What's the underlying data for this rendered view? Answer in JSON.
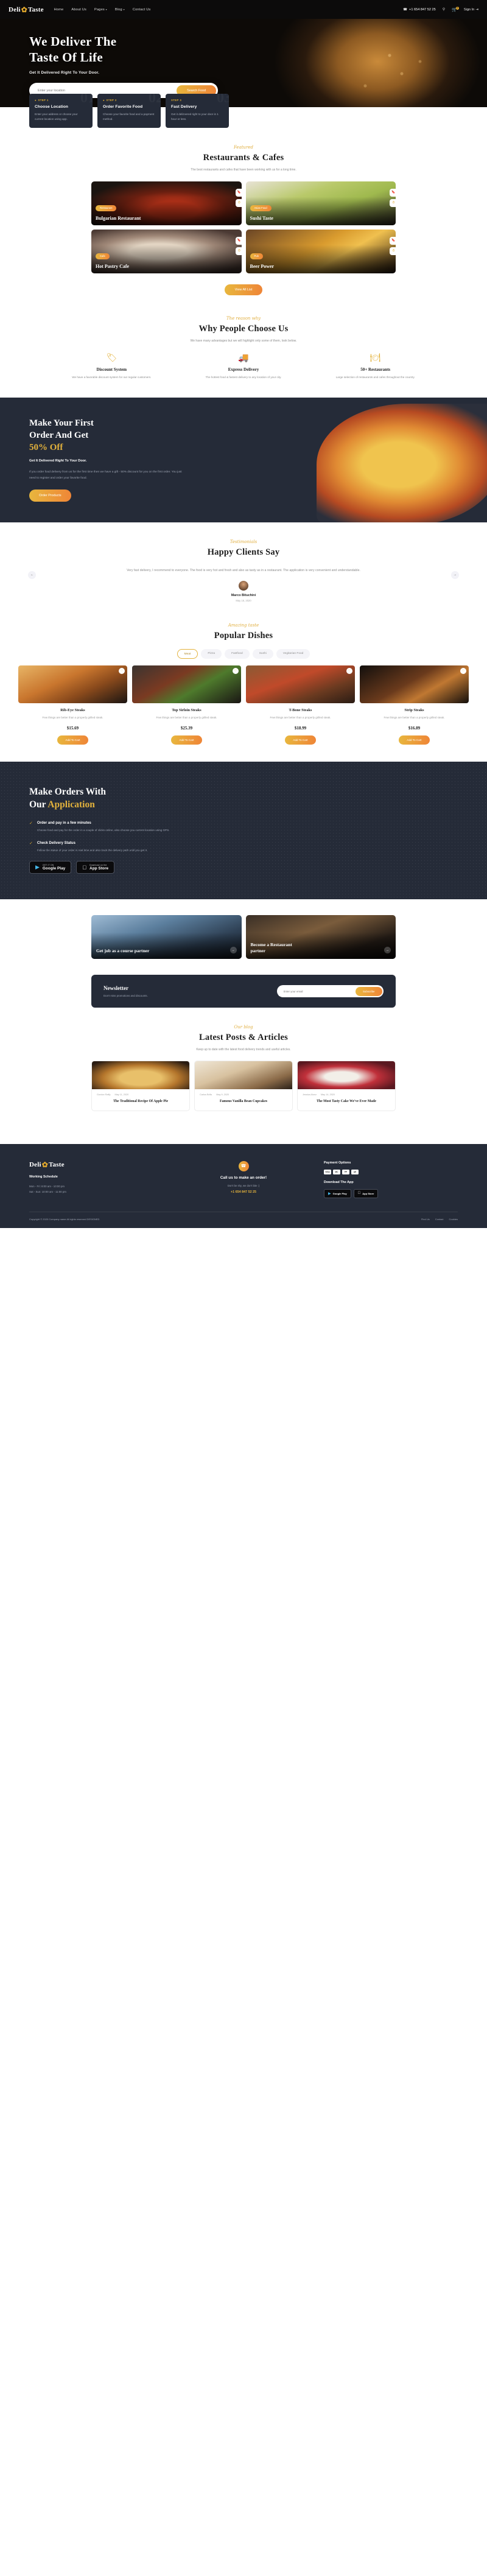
{
  "brand": {
    "name_1": "Deli",
    "name_2": "Taste",
    "flame_icon": "flame-icon"
  },
  "header": {
    "nav": [
      {
        "label": "Home",
        "caret": ""
      },
      {
        "label": "About Us",
        "caret": ""
      },
      {
        "label": "Pages",
        "caret": "▾"
      },
      {
        "label": "Blog",
        "caret": "▾"
      },
      {
        "label": "Contact Us",
        "caret": ""
      }
    ],
    "phone": "+1 654 847 52 25",
    "phone_icon": "phone-icon",
    "search_icon": "search-icon",
    "cart_icon": "cart-icon",
    "cart_count": "0",
    "signin_label": "Sign In",
    "signin_icon": "login-icon"
  },
  "hero": {
    "title_line1": "We Deliver The",
    "title_line2": "Taste Of Life",
    "subtitle": "Get It Delivered Right To Your Door.",
    "search_placeholder": "Enter your location",
    "search_button": "Search Food"
  },
  "steps": [
    {
      "num": "01",
      "tag": "STEP 1",
      "icon": "location-pin-icon",
      "title": "Choose Location",
      "text": "Enter your address or choose your current location using app."
    },
    {
      "num": "02",
      "tag": "STEP 2",
      "icon": "food-order-icon",
      "title": "Order Favorite Food",
      "text": "Choose your favorite food and a payment method."
    },
    {
      "num": "03",
      "tag": "STEP 3",
      "icon": "",
      "title": "Fast Delivery",
      "text": "Get it delizvered right to your door in 1 hour or less."
    }
  ],
  "restaurants": {
    "eyebrow": "Featured",
    "title": "Restaurants & Cafes",
    "lead": "The best restaurants and cafes that have been working with us for a long time.",
    "cards": [
      {
        "category": "Restaurant",
        "name": "Bulgarian Restaurant",
        "img": "im1"
      },
      {
        "category": "Asian Food",
        "name": "Sushi Taste",
        "img": "im2"
      },
      {
        "category": "Cafe",
        "name": "Hot Pastry Cafe",
        "img": "im3"
      },
      {
        "category": "Pub",
        "name": "Beer Power",
        "img": "im4"
      }
    ],
    "view_all": "View All List"
  },
  "why": {
    "eyebrow": "The reason why",
    "title": "Why People Choose Us",
    "lead": "We have many advantages but we will highlight only some of them, look below.",
    "features": [
      {
        "icon": "price-tag-icon",
        "glyph": "🏷",
        "title": "Discount System",
        "text": "We have a favorable discount system for our regular customers."
      },
      {
        "icon": "delivery-truck-icon",
        "glyph": "🚚",
        "title": "Express Delivery",
        "text": "The hottest food & fastest delivery to any location of your city."
      },
      {
        "icon": "food-cloche-icon",
        "glyph": "🍽",
        "title": "50+ Restaurants",
        "text": "Large selection of restaurants and cafes throughout the country."
      }
    ]
  },
  "promo": {
    "line1": "Make Your First",
    "line2": "Order And Get",
    "highlight": "50% Off",
    "subtitle": "Get It Delivered Right To Your Door.",
    "body": "If you order food delivery from us for the first time then we have a gift - 50% discount for you on the first order. You just need to register and order your favorite food.",
    "button": "Order Products"
  },
  "testimonial": {
    "eyebrow": "Testimonials",
    "title": "Happy Clients Say",
    "quote": "Very fast delivery, I recommend to everyone. The food is very hot and fresh and also as tasty as in a restaurant. The application is very convenient and understandable.",
    "name": "Marco Bituchini",
    "date": "May 16, 2020",
    "prev_icon": "arrow-left-icon",
    "next_icon": "arrow-right-icon"
  },
  "dishes": {
    "eyebrow": "Amazing taste",
    "title": "Popular Dishes",
    "tabs": [
      {
        "label": "Meat",
        "active": true
      },
      {
        "label": "Pizza",
        "active": false
      },
      {
        "label": "Fastfood",
        "active": false
      },
      {
        "label": "Sushi",
        "active": false
      },
      {
        "label": "Vegitarian Food",
        "active": false
      }
    ],
    "items": [
      {
        "name": "Rib-Eye Steaks",
        "desc": "Few things are better than a properly grilled steak.",
        "price": "$15.69",
        "cta": "Add To Cart",
        "img": "d1"
      },
      {
        "name": "Top Sirloin Steaks",
        "desc": "Few things are better than a properly grilled steak.",
        "price": "$25.39",
        "cta": "Add To Cart",
        "img": "d2"
      },
      {
        "name": "T-Bone Steaks",
        "desc": "Few things are better than a properly grilled steak.",
        "price": "$18.99",
        "cta": "Add To Cart",
        "img": "d3"
      },
      {
        "name": "Strip Steaks",
        "desc": "Few things are better than a properly grilled steak.",
        "price": "$16.89",
        "cta": "Add To Cart",
        "img": "d4"
      }
    ]
  },
  "app": {
    "line1": "Make Orders With",
    "line2_plain": "Our ",
    "line2_hl": "Application",
    "points": [
      {
        "icon": "check-circle-icon",
        "title": "Order and pay in a few minutes",
        "text": "Choose food and pay for the order in a couple of clicks online, also choose you current location using GPS."
      },
      {
        "icon": "check-circle-icon",
        "title": "Check Delivery Status",
        "text": "Follow the status of your order in real time and also track the delivery path until you get it."
      }
    ],
    "stores": [
      {
        "icon": "google-play-icon",
        "small": "GET IT ON",
        "big": "Google Play"
      },
      {
        "icon": "apple-icon",
        "small": "Download on the",
        "big": "App Store"
      }
    ]
  },
  "partners": [
    {
      "title": "Get job as a course partner",
      "arrow": "arrow-right-icon",
      "img": "p1"
    },
    {
      "title": "Become a Restaurant partner",
      "arrow": "arrow-right-icon",
      "img": "p2"
    }
  ],
  "newsletter": {
    "title": "Newsletter",
    "subtitle": "Don't miss promotions and discounts.",
    "placeholder": "Enter your email",
    "button": "Subscribe"
  },
  "blog": {
    "eyebrow": "Our blog",
    "title": "Latest Posts & Articles",
    "lead": "Keep up to date with the latest food delivery trends and useful articles.",
    "posts": [
      {
        "author": "Gordon Raffy",
        "date": "May 11, 2020",
        "title": "The Traditional Recipe Of Apple Pie",
        "img": "b1"
      },
      {
        "author": "Carlos Brills",
        "date": "May 9, 2020",
        "title": "Famous Vanilla Bean Cupcakes",
        "img": "b2"
      },
      {
        "author": "Jessica Alonz",
        "date": "May 14, 2020",
        "title": "The Most Tasty Cake We've Ever Made",
        "img": "b3"
      }
    ]
  },
  "footer": {
    "schedule_title": "Working Schedule",
    "schedule": [
      "Mon - Fri: 8:00 am - 10:00 pm",
      "Sat - Sun: 10:00 am - 11:00 pm"
    ],
    "call_icon": "phone-icon",
    "call_title": "Call us to make an order!",
    "call_sub": "Don't be shy, we don't bite :)",
    "call_phone": "+1 654 847 52 25",
    "pay_title": "Payment Options",
    "payments": [
      "VISA",
      "MC",
      "PP",
      "AE"
    ],
    "download_title": "Download The App",
    "stores": [
      {
        "icon": "google-play-icon",
        "big": "Google Play"
      },
      {
        "icon": "apple-icon",
        "big": "App Store"
      }
    ],
    "copyright": "Copyright © 2020 Company name All rights reserved DESIGNED",
    "links": [
      "Find Us",
      "Contact",
      "Cookies"
    ]
  }
}
